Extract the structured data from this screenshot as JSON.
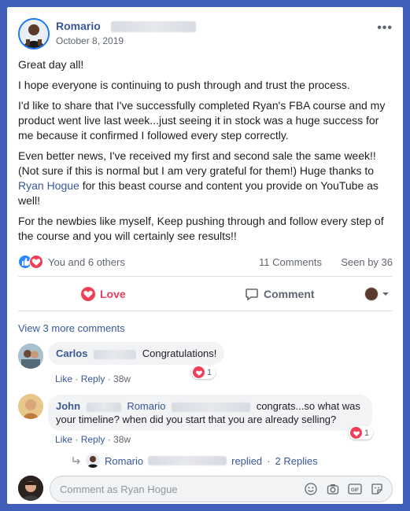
{
  "post": {
    "author": "Romario",
    "date": "October 8, 2019",
    "more_label": "•••",
    "paragraphs": {
      "p1": "Great day all!",
      "p2": "I hope everyone is continuing to push through and trust the process.",
      "p3": "I'd like to share that I've successfully completed Ryan's FBA course and my product went live last week...just seeing it in stock was a huge success for me because it confirmed I followed every step correctly.",
      "p4_a": "Even better news, I've received my first and second sale the same week!! (Not sure if this is normal but I am very grateful for them!) Huge thanks to ",
      "p4_link": "Ryan Hogue",
      "p4_b": " for this beast course and content you provide on YouTube as well!",
      "p5": "For the newbies like myself, Keep pushing through and follow every step of the course and you will certainly see results!!"
    }
  },
  "stats": {
    "reactions_text": "You and 6 others",
    "comments": "11 Comments",
    "seen": "Seen by 36"
  },
  "actions": {
    "love": "Love",
    "comment": "Comment"
  },
  "comments": {
    "view_more": "View 3 more comments",
    "items": [
      {
        "name": "Carlos",
        "text": "Congratulations!",
        "like": "Like",
        "reply": "Reply",
        "time": "38w",
        "reaction_count": "1"
      },
      {
        "name": "John",
        "mention": "Romario",
        "text": "congrats...so what was your timeline? when did you start that you are already selling?",
        "like": "Like",
        "reply": "Reply",
        "time": "38w",
        "reaction_count": "1"
      }
    ],
    "reply_summary": {
      "name": "Romario",
      "action": "replied",
      "sep": "·",
      "count": "2 Replies"
    }
  },
  "composer": {
    "placeholder": "Comment as Ryan Hogue"
  },
  "colors": {
    "frame": "#3f5fb8",
    "link": "#385898",
    "love": "#e4405f",
    "like": "#2d88ff"
  },
  "icons": [
    "more-icon",
    "like-reaction-icon",
    "love-reaction-icon",
    "heart-icon",
    "comment-icon",
    "chevron-down-icon",
    "reply-arrow-icon",
    "emoji-icon",
    "camera-icon",
    "gif-icon",
    "sticker-icon"
  ]
}
